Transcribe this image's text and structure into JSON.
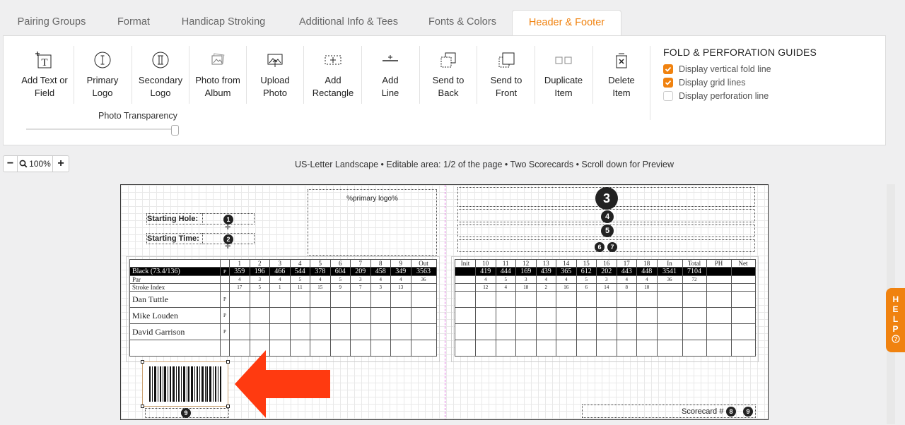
{
  "tabs": [
    {
      "label": "Pairing Groups"
    },
    {
      "label": "Format"
    },
    {
      "label": "Handicap Stroking"
    },
    {
      "label": "Additional Info & Tees"
    },
    {
      "label": "Fonts & Colors"
    },
    {
      "label": "Header & Footer"
    }
  ],
  "tools": [
    {
      "line1": "Add Text or",
      "line2": "Field",
      "icon": "text-add-icon"
    },
    {
      "line1": "Primary",
      "line2": "Logo",
      "icon": "primary-logo-icon"
    },
    {
      "line1": "Secondary",
      "line2": "Logo",
      "icon": "secondary-logo-icon"
    },
    {
      "line1": "Photo from",
      "line2": "Album",
      "icon": "photo-album-icon"
    },
    {
      "line1": "Upload",
      "line2": "Photo",
      "icon": "upload-photo-icon"
    },
    {
      "line1": "Add",
      "line2": "Rectangle",
      "icon": "rectangle-icon"
    },
    {
      "line1": "Add",
      "line2": "Line",
      "icon": "line-icon"
    },
    {
      "line1": "Send to",
      "line2": "Back",
      "icon": "send-back-icon"
    },
    {
      "line1": "Send to",
      "line2": "Front",
      "icon": "send-front-icon"
    },
    {
      "line1": "Duplicate",
      "line2": "Item",
      "icon": "duplicate-icon"
    },
    {
      "line1": "Delete",
      "line2": "Item",
      "icon": "trash-icon"
    }
  ],
  "fold": {
    "title": "FOLD & PERFORATION GUIDES",
    "options": [
      {
        "label": "Display vertical fold line",
        "checked": true
      },
      {
        "label": "Display grid lines",
        "checked": true
      },
      {
        "label": "Display perforation line",
        "checked": false
      }
    ]
  },
  "transparency": {
    "label": "Photo Transparency",
    "value": 1.0
  },
  "zoom": {
    "minus": "−",
    "value": "100%",
    "plus": "+"
  },
  "info": "US-Letter Landscape • Editable area: 1/2 of the page • Two Scorecards • Scroll down for Preview",
  "card": {
    "starting_hole_label": "Starting Hole:",
    "starting_time_label": "Starting Time:",
    "logo_placeholder": "%primary logo%",
    "scorecard_label": "Scorecard #",
    "markers": {
      "m1": "1",
      "m2": "2",
      "m3": "3",
      "m4": "4",
      "m5": "5",
      "m6": "6",
      "m7": "7",
      "m8": "8",
      "m9": "9",
      "m9b": "9"
    }
  },
  "front": {
    "headers": [
      "",
      "",
      "1",
      "2",
      "3",
      "4",
      "5",
      "6",
      "7",
      "8",
      "9",
      "Out"
    ],
    "tee": [
      "Black (73.4/136)",
      "P",
      "359",
      "196",
      "466",
      "544",
      "378",
      "604",
      "209",
      "458",
      "349",
      "3563"
    ],
    "par": [
      "Par",
      "",
      "4",
      "3",
      "4",
      "5",
      "4",
      "5",
      "3",
      "4",
      "4",
      "36"
    ],
    "si": [
      "Stroke Index",
      "",
      "17",
      "5",
      "1",
      "11",
      "15",
      "9",
      "7",
      "3",
      "13",
      ""
    ],
    "players": [
      {
        "name": "Dan Tuttle",
        "p": "P"
      },
      {
        "name": "Mike Louden",
        "p": "P"
      },
      {
        "name": "David Garrison",
        "p": "P"
      }
    ]
  },
  "back": {
    "headers": [
      "Init",
      "10",
      "11",
      "12",
      "13",
      "14",
      "15",
      "16",
      "17",
      "18",
      "In",
      "Total",
      "PH",
      "Net"
    ],
    "tee": [
      "",
      "419",
      "444",
      "169",
      "439",
      "365",
      "612",
      "202",
      "443",
      "448",
      "3541",
      "7104",
      "",
      ""
    ],
    "par": [
      "",
      "4",
      "5",
      "3",
      "4",
      "4",
      "5",
      "3",
      "4",
      "4",
      "36",
      "72",
      "",
      ""
    ],
    "si": [
      "",
      "12",
      "4",
      "18",
      "2",
      "16",
      "6",
      "14",
      "8",
      "10",
      "",
      "",
      "",
      ""
    ]
  },
  "help": {
    "label": "HELP"
  },
  "colors": {
    "accent": "#f0820f",
    "arrow": "#ff3a10",
    "fold_line": "#e070e0"
  }
}
